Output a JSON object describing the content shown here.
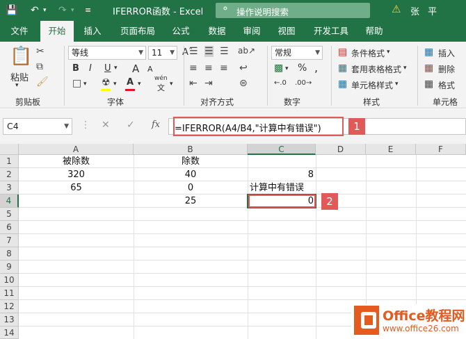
{
  "window": {
    "title": "IFERROR函数 - Excel",
    "tell_me": "操作说明搜索",
    "user": "张 平"
  },
  "tabs": [
    "文件",
    "开始",
    "插入",
    "页面布局",
    "公式",
    "数据",
    "审阅",
    "视图",
    "开发工具",
    "帮助"
  ],
  "active_tab": "开始",
  "ribbon": {
    "clipboard": {
      "paste": "粘贴",
      "label": "剪贴板"
    },
    "font": {
      "name": "等线",
      "size": "11",
      "bold": "B",
      "italic": "I",
      "underline": "U",
      "grow": "A",
      "shrink": "A",
      "wen": "wén",
      "label": "字体"
    },
    "alignment": {
      "label": "对齐方式"
    },
    "number": {
      "format": "常规",
      "percent": "%",
      "comma": ",",
      "label": "数字"
    },
    "styles": {
      "conditional": "条件格式",
      "table": "套用表格格式",
      "cell_styles": "单元格样式",
      "label": "样式"
    },
    "cells": {
      "insert": "插入",
      "delete": "删除",
      "format": "格式",
      "label": "单元格"
    }
  },
  "formula_bar": {
    "name_box": "C4",
    "fx": "fx",
    "formula": "=IFERROR(A4/B4,\"计算中有错误\")"
  },
  "callouts": [
    "1",
    "2"
  ],
  "columns": [
    "A",
    "B",
    "C",
    "D",
    "E",
    "F"
  ],
  "selected_column": "C",
  "rows": [
    "1",
    "2",
    "3",
    "4",
    "5",
    "6",
    "7",
    "8",
    "9",
    "10",
    "11",
    "12",
    "13",
    "14"
  ],
  "selected_row": "4",
  "cells": {
    "A1": "被除数",
    "B1": "除数",
    "A2": "320",
    "B2": "40",
    "C2": "8",
    "A3": "65",
    "B3": "0",
    "C3": "计算中有错误",
    "B4": "25",
    "C4": "0"
  },
  "watermark": {
    "brand": "Office教程网",
    "url": "www.office26.com"
  },
  "colors": {
    "excel_green": "#217346",
    "callout_red": "#e05a5a",
    "brand_orange": "#e35b1f"
  }
}
